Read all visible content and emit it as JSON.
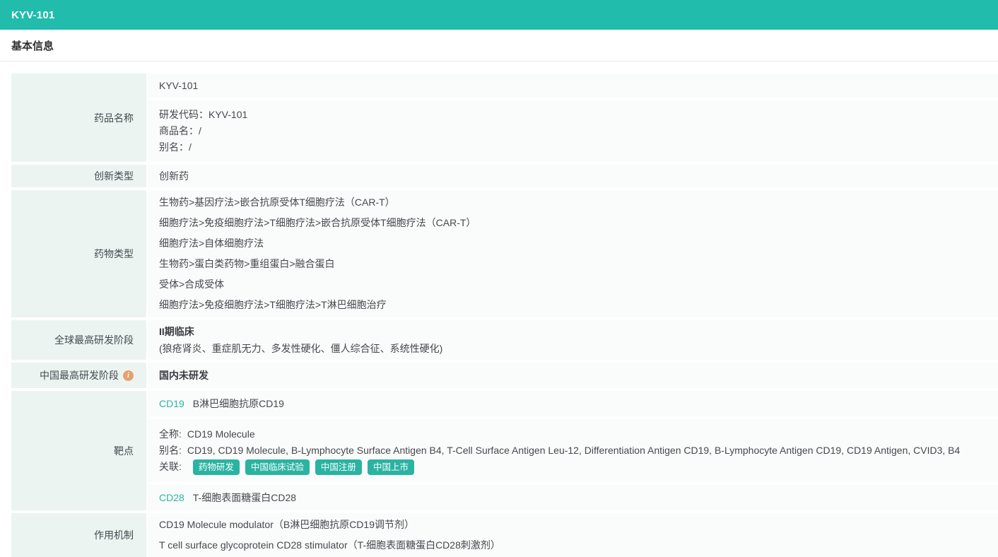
{
  "page": {
    "title": "KYV-101",
    "section_title": "基本信息"
  },
  "colors": {
    "header_teal": "#21bcab",
    "label_cell_bg": "#ecf4f2",
    "value_cell_bg": "#fafbfb",
    "link_teal": "#2ab5a4",
    "button_teal": "#2bb3a2",
    "info_icon_orange": "#e8a06d",
    "text": "#45494d"
  },
  "rows": {
    "drug_name": {
      "label": "药品名称",
      "name": "KYV-101",
      "dev_code_label": "研发代码：",
      "dev_code": "KYV-101",
      "trade_name_label": "商品名：",
      "trade_name": "/",
      "alias_label": "别名：",
      "alias": "/"
    },
    "innovation_type": {
      "label": "创新类型",
      "value": "创新药"
    },
    "drug_type": {
      "label": "药物类型",
      "values": [
        "生物药>基因疗法>嵌合抗原受体T细胞疗法（CAR-T）",
        "细胞疗法>免疫细胞疗法>T细胞疗法>嵌合抗原受体T细胞疗法（CAR-T）",
        "细胞疗法>自体细胞疗法",
        "生物药>蛋白类药物>重组蛋白>融合蛋白",
        "受体>合成受体",
        "细胞疗法>免疫细胞疗法>T细胞疗法>T淋巴细胞治疗"
      ]
    },
    "global_stage": {
      "label": "全球最高研发阶段",
      "stage": "II期临床",
      "indications": "(狼疮肾炎、重症肌无力、多发性硬化、僵人综合征、系统性硬化)"
    },
    "china_stage": {
      "label": "中国最高研发阶段",
      "info_icon": "i",
      "value": "国内未研发"
    },
    "target": {
      "label": "靶点",
      "target1_code": "CD19",
      "target1_desc": "B淋巴细胞抗原CD19",
      "full_name_label": "全称:",
      "full_name": "CD19 Molecule",
      "alias_label": "别名:",
      "alias": "CD19, CD19 Molecule, B-Lymphocyte Surface Antigen B4, T-Cell Surface Antigen Leu-12, Differentiation Antigen CD19, B-Lymphocyte Antigen CD19, CD19 Antigen, CVID3, B4",
      "relation_label": "关联:",
      "relation_buttons": [
        "药物研发",
        "中国临床试验",
        "中国注册",
        "中国上市"
      ],
      "target2_code": "CD28",
      "target2_desc": "T-细胞表面糖蛋白CD28"
    },
    "mechanism": {
      "label": "作用机制",
      "values": [
        "CD19 Molecule modulator（B淋巴细胞抗原CD19调节剂）",
        "T cell surface glycoprotein CD28 stimulator（T-细胞表面糖蛋白CD28刺激剂）"
      ]
    }
  }
}
